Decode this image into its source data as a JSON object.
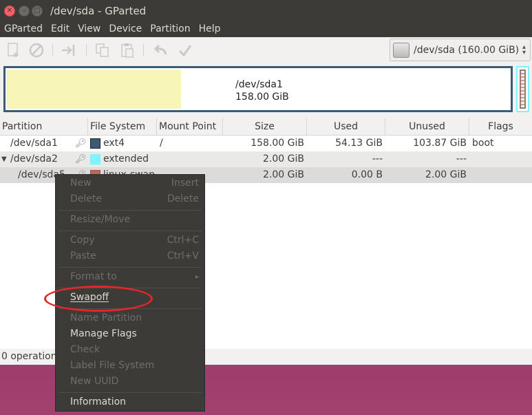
{
  "window": {
    "title": "/dev/sda - GParted"
  },
  "menubar": [
    "GParted",
    "Edit",
    "View",
    "Device",
    "Partition",
    "Help"
  ],
  "toolbar": {
    "buttons": [
      "new-partition-icon",
      "delete-icon",
      "resize-move-icon",
      "copy-icon",
      "paste-icon",
      "undo-icon",
      "apply-icon"
    ]
  },
  "device_selector": {
    "value": "/dev/sda  (160.00 GiB)"
  },
  "disk_map": {
    "partition_name": "/dev/sda1",
    "partition_size": "158.00 GiB"
  },
  "table": {
    "headers": [
      "Partition",
      "File System",
      "Mount Point",
      "Size",
      "Used",
      "Unused",
      "Flags"
    ],
    "rows": [
      {
        "partition": "/dev/sda1",
        "fs": "ext4",
        "fs_color": "#3d5a73",
        "mount": "/",
        "size": "158.00 GiB",
        "used": "54.13 GiB",
        "unused": "103.87 GiB",
        "flags": "boot"
      },
      {
        "partition": "/dev/sda2",
        "fs": "extended",
        "fs_color": "#7ff3ff",
        "mount": "",
        "size": "2.00 GiB",
        "used": "---",
        "unused": "---",
        "flags": ""
      },
      {
        "partition": "/dev/sda5",
        "fs": "linux-swap",
        "fs_color": "#c1665a",
        "mount": "",
        "size": "2.00 GiB",
        "used": "0.00 B",
        "unused": "2.00 GiB",
        "flags": ""
      }
    ]
  },
  "status": {
    "text": "0 operations pending"
  },
  "context_menu": {
    "items": [
      {
        "label": "New",
        "accel": "Insert",
        "enabled": false
      },
      {
        "label": "Delete",
        "accel": "Delete",
        "enabled": false
      },
      {
        "label": "Resize/Move",
        "accel": "",
        "enabled": false
      },
      {
        "label": "Copy",
        "accel": "Ctrl+C",
        "enabled": false
      },
      {
        "label": "Paste",
        "accel": "Ctrl+V",
        "enabled": false
      },
      {
        "label": "Format to",
        "accel": "",
        "enabled": false,
        "submenu": true
      },
      {
        "label": "Swapoff",
        "accel": "",
        "enabled": true
      },
      {
        "label": "Name Partition",
        "accel": "",
        "enabled": false
      },
      {
        "label": "Manage Flags",
        "accel": "",
        "enabled": true
      },
      {
        "label": "Check",
        "accel": "",
        "enabled": false
      },
      {
        "label": "Label File System",
        "accel": "",
        "enabled": false
      },
      {
        "label": "New UUID",
        "accel": "",
        "enabled": false
      },
      {
        "label": "Information",
        "accel": "",
        "enabled": true
      }
    ]
  },
  "colors": {
    "highlight": "#e3262a",
    "used_space": "#f8f5b8",
    "partition_border": "#3d5a73"
  }
}
